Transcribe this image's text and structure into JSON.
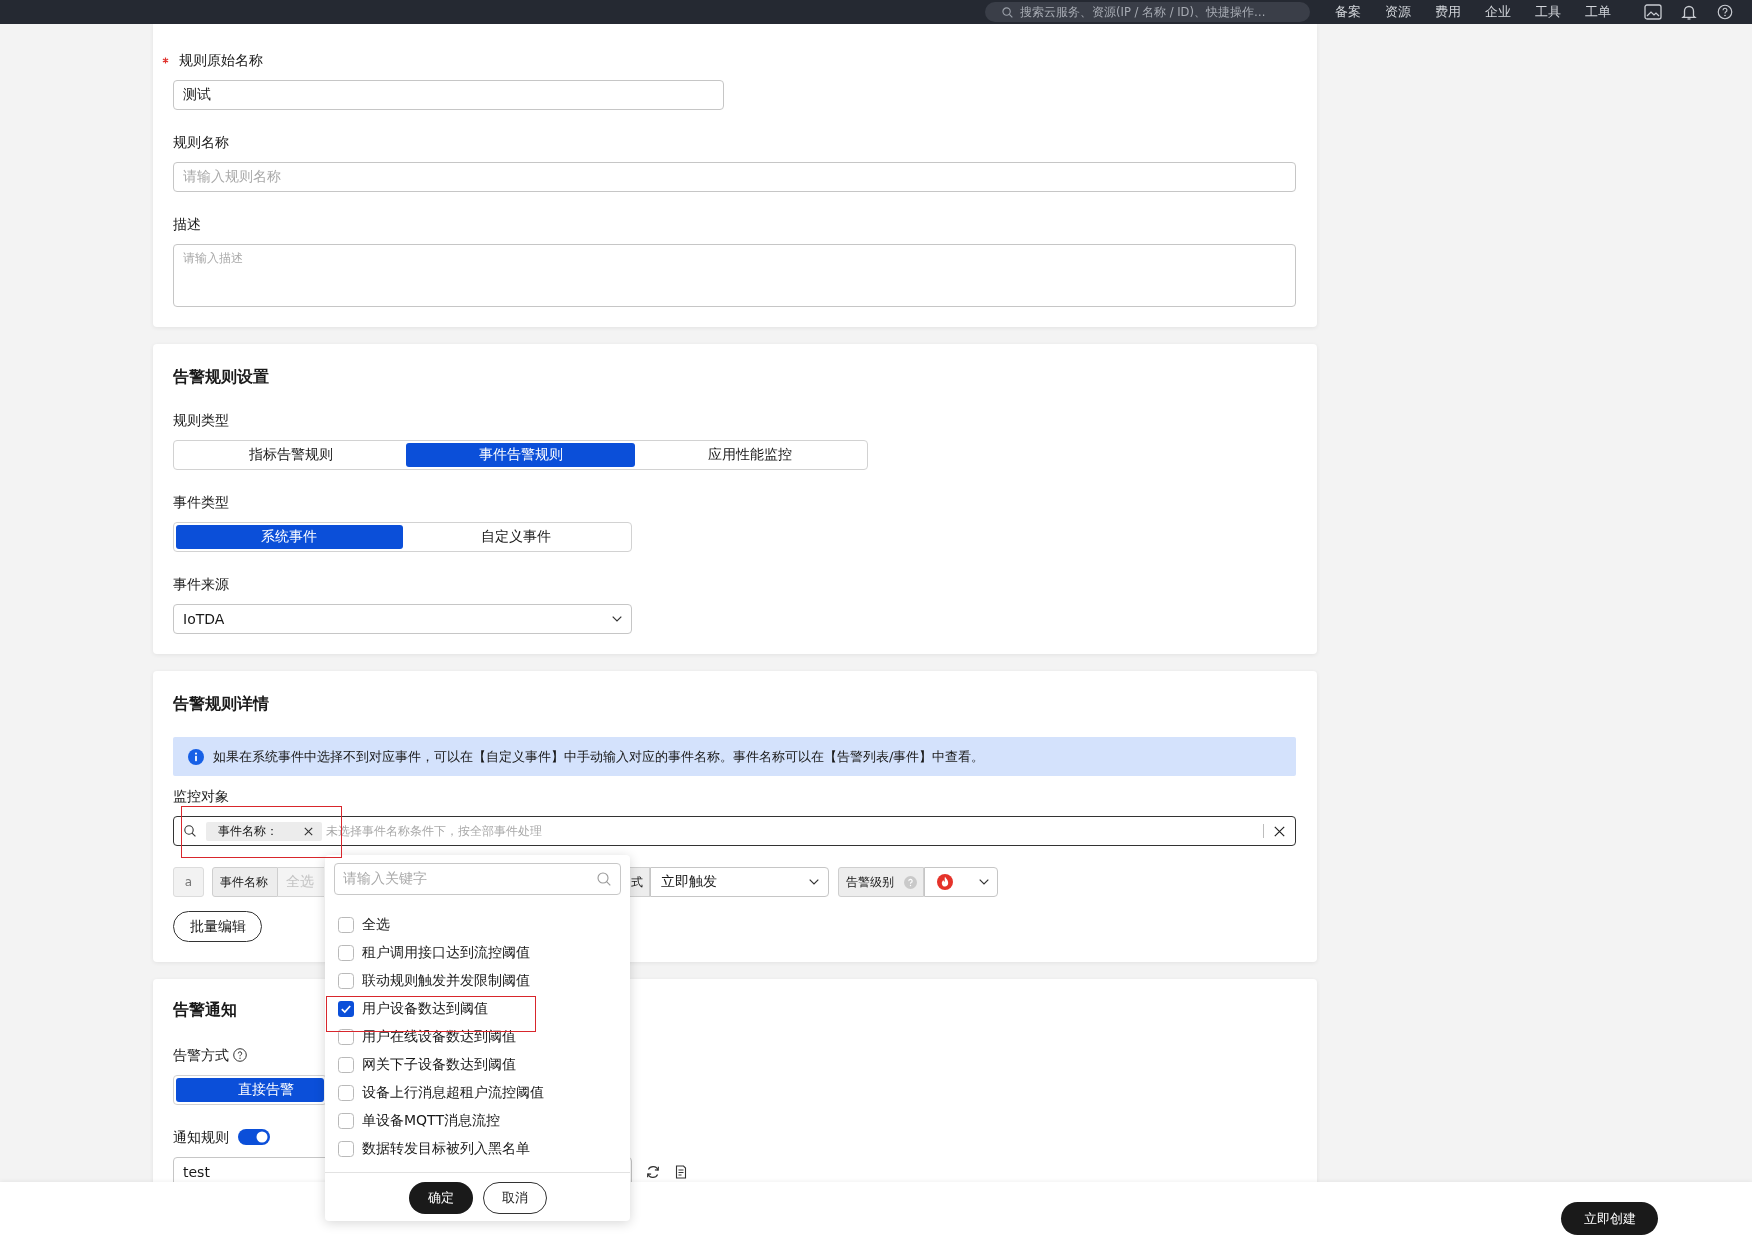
{
  "top_bar": {
    "search": {
      "placeholder": "搜索云服务、资源(IP / 名称 / ID)、快捷操作…"
    },
    "menu": [
      "备案",
      "资源",
      "费用",
      "企业",
      "工具",
      "工单"
    ]
  },
  "basic_info": {
    "fields": [
      {
        "kind": "short_text",
        "label": "规则原始名称",
        "required": true,
        "value": "测试"
      },
      {
        "kind": "text",
        "label": "规则名称",
        "required": false,
        "placeholder": "请输入规则名称"
      },
      {
        "kind": "textarea",
        "label": "描述",
        "required": false,
        "placeholder": "请输入描述"
      }
    ]
  },
  "rule_settings": {
    "title": "告警规则设置",
    "rule_type": {
      "label": "规则类型",
      "options": [
        {
          "label": "指标告警规则",
          "selected": false
        },
        {
          "label": "事件告警规则",
          "selected": true
        },
        {
          "label": "应用性能监控",
          "selected": false
        }
      ]
    },
    "event_type": {
      "label": "事件类型",
      "options": [
        {
          "label": "系统事件",
          "selected": true
        },
        {
          "label": "自定义事件",
          "selected": false
        }
      ]
    },
    "event_source": {
      "label": "事件来源",
      "value": "IoTDA"
    }
  },
  "rule_details": {
    "title": "告警规则详情",
    "notice": "如果在系统事件中选择不到对应事件，可以在【自定义事件】中手动输入对应的事件名称。事件名称可以在【告警列表/事件】中查看。",
    "monitor_object": {
      "label": "监控对象",
      "tag": "事件名称：",
      "placeholder": "未选择事件名称条件下，按全部事件处理",
      "annotated": true
    },
    "condition": {
      "prefix": "a",
      "event_name": {
        "label": "事件名称",
        "placeholder": "全选",
        "disabled": true
      },
      "trigger": {
        "label": "式",
        "value": "立即触发"
      },
      "severity": {
        "label": "告警级别"
      }
    },
    "batch_edit": "批量编辑"
  },
  "notification": {
    "title": "告警通知",
    "method": {
      "label": "告警方式",
      "options": [
        {
          "label": "直接告警",
          "selected": true
        }
      ]
    },
    "notify_rule": {
      "label": "通知规则",
      "on": true,
      "value": "test"
    }
  },
  "event_dropdown": {
    "search": {
      "placeholder": "请输入关键字"
    },
    "options": [
      {
        "label": "全选",
        "checked": false,
        "annotated": false
      },
      {
        "label": "租户调用接口达到流控阈值",
        "checked": false,
        "annotated": false
      },
      {
        "label": "联动规则触发并发限制阈值",
        "checked": false,
        "annotated": false
      },
      {
        "label": "用户设备数达到阈值",
        "checked": true,
        "annotated": true
      },
      {
        "label": "用户在线设备数达到阈值",
        "checked": false,
        "annotated": false
      },
      {
        "label": "网关下子设备数达到阈值",
        "checked": false,
        "annotated": false
      },
      {
        "label": "设备上行消息超租户流控阈值",
        "checked": false,
        "annotated": false
      },
      {
        "label": "单设备MQTT消息流控",
        "checked": false,
        "annotated": false
      },
      {
        "label": "数据转发目标被列入黑名单",
        "checked": false,
        "annotated": false
      }
    ],
    "confirm": "确定",
    "cancel": "取消"
  },
  "footer": {
    "create_button": "立即创建"
  }
}
